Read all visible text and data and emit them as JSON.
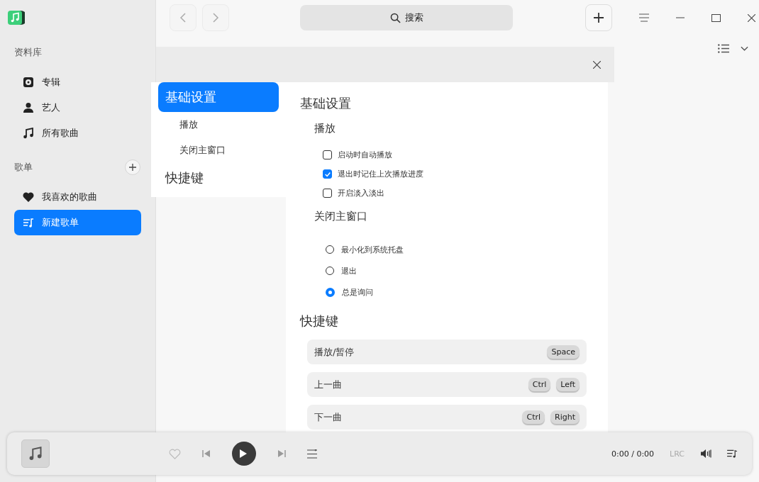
{
  "search": {
    "label": "搜索"
  },
  "sidebar": {
    "sections": [
      {
        "title": "资料库",
        "add_button": false,
        "items": [
          {
            "label": "专辑",
            "selected": false
          },
          {
            "label": "艺人",
            "selected": false
          },
          {
            "label": "所有歌曲",
            "selected": false
          }
        ]
      },
      {
        "title": "歌单",
        "add_button": true,
        "items": [
          {
            "label": "我喜欢的歌曲",
            "selected": false
          },
          {
            "label": "新建歌单",
            "selected": true
          }
        ]
      }
    ]
  },
  "settings": {
    "nav": [
      {
        "label": "基础设置",
        "selected": true,
        "children": [
          {
            "label": "播放"
          },
          {
            "label": "关闭主窗口"
          }
        ]
      },
      {
        "label": "快捷键",
        "selected": false
      }
    ],
    "title": "基础设置",
    "groups": [
      {
        "title": "播放",
        "kind": "checkbox",
        "options": [
          {
            "label": "启动时自动播放",
            "checked": false
          },
          {
            "label": "退出时记住上次播放进度",
            "checked": true
          },
          {
            "label": "开启淡入淡出",
            "checked": false
          }
        ]
      },
      {
        "title": "关闭主窗口",
        "kind": "radio",
        "options": [
          {
            "label": "最小化到系统托盘",
            "selected": false
          },
          {
            "label": "退出",
            "selected": false
          },
          {
            "label": "总是询问",
            "selected": true
          }
        ]
      }
    ],
    "shortcuts_title": "快捷键",
    "shortcuts": [
      {
        "action": "播放/暂停",
        "keys": [
          "Space"
        ]
      },
      {
        "action": "上一曲",
        "keys": [
          "Ctrl",
          "Left"
        ]
      },
      {
        "action": "下一曲",
        "keys": [
          "Ctrl",
          "Right"
        ]
      }
    ]
  },
  "player": {
    "time": "0:00 / 0:00",
    "lyrics": "LRC"
  }
}
